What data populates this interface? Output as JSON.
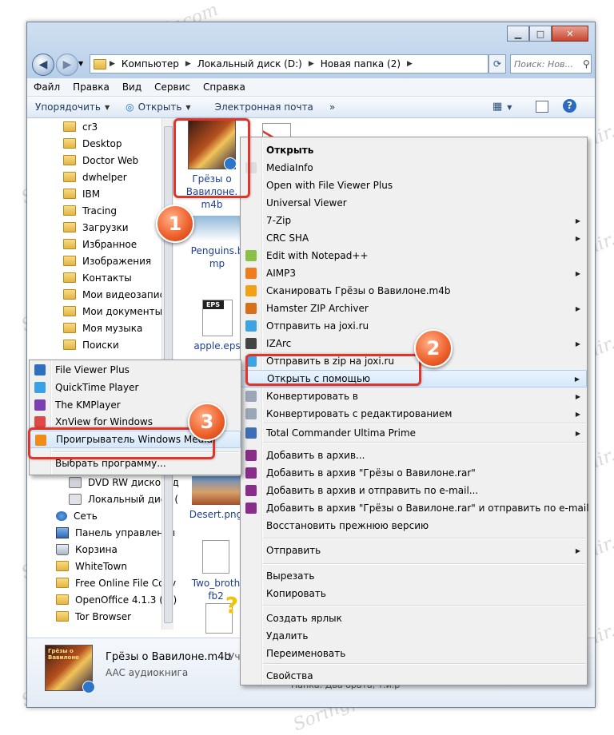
{
  "window": {
    "controls": {
      "minimize": "▁",
      "maximize": "□",
      "close": "✕"
    }
  },
  "address_bar": {
    "segments": [
      "Компьютер",
      "Локальный диск (D:)",
      "Новая папка (2)"
    ],
    "search_placeholder": "Поиск: Нов..."
  },
  "menubar": [
    "Файл",
    "Правка",
    "Вид",
    "Сервис",
    "Справка"
  ],
  "toolbar": {
    "organize": "Упорядочить",
    "open": "Открыть",
    "email": "Электронная почта",
    "more": "»"
  },
  "tree": {
    "items_top": [
      "cr3",
      "Desktop",
      "Doctor Web",
      "dwhelper",
      "IBM",
      "Tracing",
      "Загрузки",
      "Избранное",
      "Изображения",
      "Контакты",
      "Мои видеозаписи",
      "Мои документы",
      "Моя музыка",
      "Поиски"
    ],
    "items_bottom": [
      "DVD RW дисковод",
      "Локальный диск (",
      "Сеть",
      "Панель управления",
      "Корзина",
      "WhiteTown",
      "Free Online File Conv",
      "OpenOffice 4.1.3 (ru)",
      "Tor Browser"
    ]
  },
  "files": [
    {
      "name": "Грёзы о Вавилоне.m4b"
    },
    {
      "name": "Penguins.bmp"
    },
    {
      "name": "apple.eps"
    },
    {
      "name": "Desert.png"
    },
    {
      "name": "Two_brothers.fb2"
    }
  ],
  "file_labels": {
    "file0_l1": "Грёзы о",
    "file0_l2": "Вавилоне.",
    "file0_l3": "m4b",
    "file1_l1": "Penguins.b",
    "file1_l2": "mp",
    "file2_l1": "apple.eps",
    "file2_badge": "EPS",
    "file3_l1": "Desert.png",
    "file4_l1": "Two_broth",
    "file4_l2": "fb2"
  },
  "details": {
    "title": "Грёзы о Вавилоне.m4b",
    "type": "AAC аудиокнига",
    "extra": "Уча",
    "cover_text": "Грёзы о Вавилоне"
  },
  "context_menu": {
    "items": [
      {
        "label": "Открыть",
        "bold": true
      },
      {
        "label": "MediaInfo"
      },
      {
        "label": "Open with File Viewer Plus"
      },
      {
        "label": "Universal Viewer"
      },
      {
        "label": "7-Zip",
        "submenu": true
      },
      {
        "label": "CRC SHA",
        "submenu": true
      },
      {
        "label": "Edit with Notepad++"
      },
      {
        "label": "AIMP3",
        "submenu": true
      },
      {
        "label": "Сканировать Грёзы о Вавилоне.m4b"
      },
      {
        "label": "Hamster ZIP Archiver",
        "submenu": true
      },
      {
        "label": "Отправить на joxi.ru"
      },
      {
        "label": "IZArc",
        "submenu": true
      },
      {
        "label": "Отправить в zip на joxi.ru"
      },
      {
        "label": "Открыть с помощью",
        "submenu": true,
        "highlighted": true
      },
      {
        "label": "Конвертировать в",
        "submenu": true
      },
      {
        "label": "Конвертировать с редактированием",
        "submenu": true
      },
      {
        "label": "Total Commander Ultima Prime",
        "submenu": true
      },
      {
        "label": "Добавить в архив..."
      },
      {
        "label": "Добавить в архив \"Грёзы о Вавилоне.rar\""
      },
      {
        "label": "Добавить в архив и отправить по e-mail..."
      },
      {
        "label": "Добавить в архив \"Грёзы о Вавилоне.rar\" и отправить по e-mail"
      },
      {
        "label": "Восстановить прежнюю версию"
      },
      {
        "label": "Отправить",
        "submenu": true
      },
      {
        "label": "Вырезать"
      },
      {
        "label": "Копировать"
      },
      {
        "label": "Создать ярлык"
      },
      {
        "label": "Удалить"
      },
      {
        "label": "Переименовать"
      },
      {
        "label": "Свойства"
      }
    ]
  },
  "open_with_menu": {
    "items": [
      {
        "label": "File Viewer Plus"
      },
      {
        "label": "QuickTime Player"
      },
      {
        "label": "The KMPlayer"
      },
      {
        "label": "XnView for Windows"
      },
      {
        "label": "Проигрыватель Windows Media",
        "highlighted": true
      },
      {
        "label": "Выбрать программу..."
      }
    ]
  },
  "callouts": [
    "1",
    "2",
    "3"
  ],
  "watermark": "Soringpcrepair.com",
  "background_text": "Папка: Два брата, т.и.р"
}
